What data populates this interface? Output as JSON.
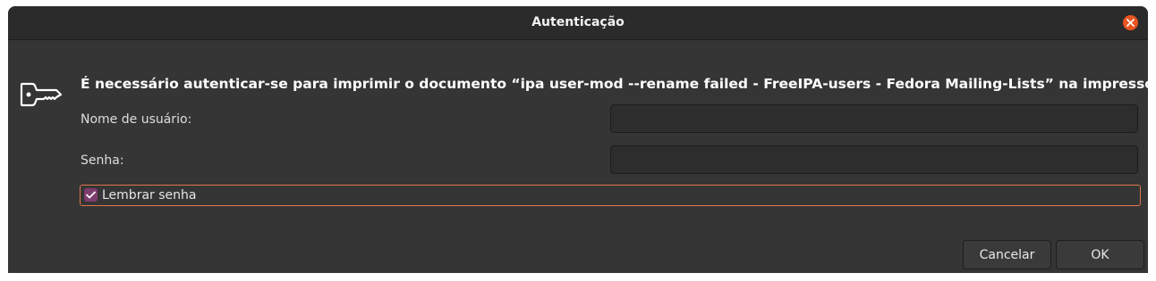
{
  "dialog": {
    "title": "Autenticação",
    "message": "É necessário autenticar-se para imprimir o documento “ipa user-mod --rename failed - FreeIPA-users - Fedora Mailing-Lists” na impressora test",
    "username_label": "Nome de usuário:",
    "username_value": "",
    "password_label": "Senha:",
    "password_value": "",
    "remember_label": "Lembrar senha",
    "remember_checked": true,
    "cancel_label": "Cancelar",
    "ok_label": "OK"
  },
  "icons": {
    "close": "close-icon",
    "key": "key-icon",
    "check": "checkmark-icon"
  },
  "colors": {
    "accent": "#e95420",
    "checkbox": "#7d3c6e",
    "focus_border": "#e0754a",
    "window_bg": "#353535"
  }
}
